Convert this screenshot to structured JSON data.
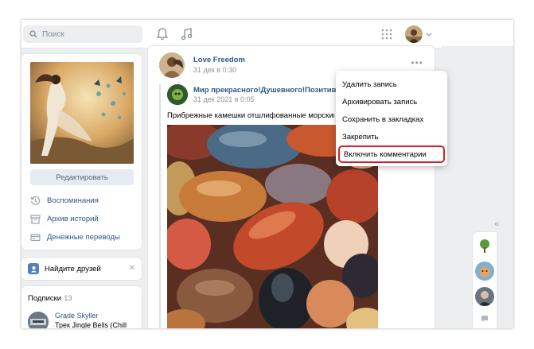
{
  "search": {
    "placeholder": "Поиск"
  },
  "icons": {
    "notifications": "bell-icon",
    "music": "music-note-icon",
    "apps": "grid-icon",
    "account": "avatar-chevron"
  },
  "profile": {
    "edit_label": "Редактировать",
    "menu": [
      {
        "icon": "clock-back-icon",
        "label": "Воспоминания"
      },
      {
        "icon": "archive-icon",
        "label": "Архив историй"
      },
      {
        "icon": "money-transfer-icon",
        "label": "Денежные переводы"
      }
    ]
  },
  "find_friends": {
    "label": "Найдите друзей",
    "close": "✕"
  },
  "subscriptions": {
    "title": "Подписки",
    "count": "13",
    "items": [
      {
        "name": "Grade Skyller",
        "desc": "Трек Jingle Bells (Chill"
      }
    ]
  },
  "post": {
    "author": "Love Freedom",
    "date": "31 дек в 0:30",
    "more": "•••",
    "repost": {
      "author": "Мир прекрасного!Душевного!Позитивного н",
      "date": "31 дек 2021 в 0:05"
    },
    "text": "Прибрежные камешки отшлифованные морским пр"
  },
  "post_menu": {
    "items": [
      "Удалить запись",
      "Архивировать запись",
      "Сохранить в закладках",
      "Закрепить",
      "Включить комментарии"
    ],
    "highlight_color": "#d8202a"
  },
  "right": {
    "collapse": "«"
  }
}
